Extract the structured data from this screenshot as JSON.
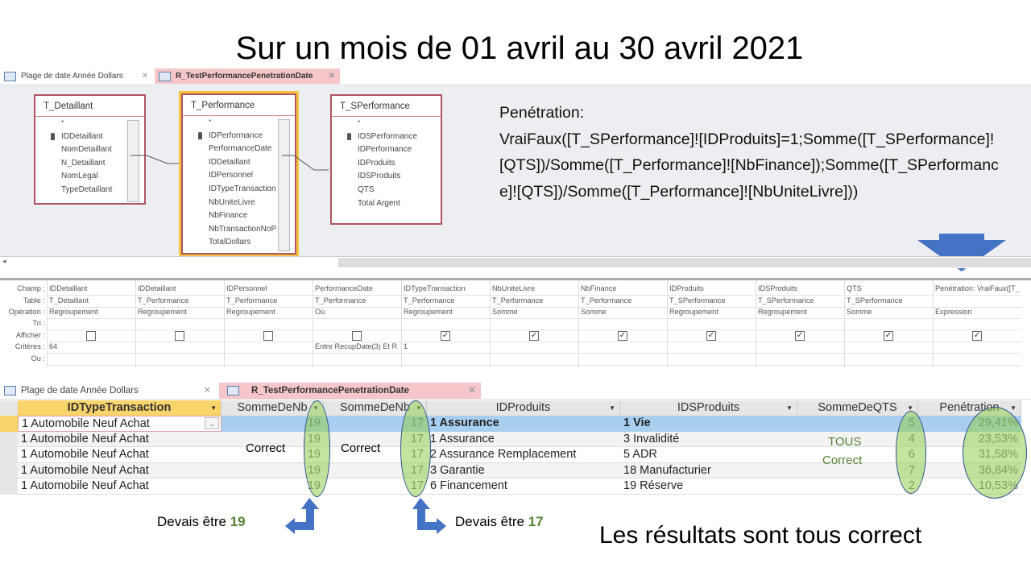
{
  "title": "Sur un mois de 01 avril au 30 avril 2021",
  "top_tabs": [
    {
      "label": "Plage de date Année Dollars"
    },
    {
      "label": "R_TestPerformancePenetrationDate"
    }
  ],
  "tables": [
    {
      "name": "T_Detaillant",
      "fields": [
        "*",
        "IDDetaillant",
        "NomDetaillant",
        "N_Detaillant",
        "NomLegal",
        "TypeDetaillant"
      ]
    },
    {
      "name": "T_Performance",
      "fields": [
        "*",
        "IDPerformance",
        "PerformanceDate",
        "IDDetaillant",
        "IDPersonnel",
        "IDTypeTransaction",
        "NbUniteLivre",
        "NbFinance",
        "NbTransactionNoP",
        "TotalDollars"
      ]
    },
    {
      "name": "T_SPerformance",
      "fields": [
        "*",
        "IDSPerformance",
        "IDPerformance",
        "IDProduits",
        "IDSProduits",
        "QTS",
        "Total Argent"
      ]
    }
  ],
  "formula": "Penétration: VraiFaux([T_SPerformance]![IDProduits]=1;Somme([T_SPerformance]![QTS])/Somme([T_Performance]![NbFinance]);Somme([T_SPerformance]![QTS])/Somme([T_Performance]![NbUniteLivre]))",
  "formula_label": "Penétration:",
  "formula_body": "VraiFaux([T_SPerformance]![IDProduits]=1;Somme([T_SPerformance]![QTS])/Somme([T_Performance]![NbFinance]);Somme([T_SPerformance]![QTS])/Somme([T_Performance]![NbUniteLivre]))",
  "grid": {
    "row_labels": [
      "Champ :",
      "Table :",
      "Opération :",
      "Tri :",
      "Afficher :",
      "Critères :",
      "Ou :"
    ],
    "columns": [
      {
        "champ": "IDDetaillant",
        "table": "T_Detaillant",
        "op": "Regroupement",
        "show": false,
        "crit": "64"
      },
      {
        "champ": "IDDetaillant",
        "table": "T_Performance",
        "op": "Regroupement",
        "show": false,
        "crit": ""
      },
      {
        "champ": "IDPersonnel",
        "table": "T_Performance",
        "op": "Regroupement",
        "show": false,
        "crit": ""
      },
      {
        "champ": "PerformanceDate",
        "table": "T_Performance",
        "op": "Où",
        "show": false,
        "crit": "Entre RecupDate(3) Et R"
      },
      {
        "champ": "IDTypeTransaction",
        "table": "T_Performance",
        "op": "Regroupement",
        "show": true,
        "crit": "1"
      },
      {
        "champ": "NbUniteLivre",
        "table": "T_Performance",
        "op": "Somme",
        "show": true,
        "crit": ""
      },
      {
        "champ": "NbFinance",
        "table": "T_Performance",
        "op": "Somme",
        "show": true,
        "crit": ""
      },
      {
        "champ": "IDProduits",
        "table": "T_SPerformance",
        "op": "Regroupement",
        "show": true,
        "crit": ""
      },
      {
        "champ": "IDSProduits",
        "table": "T_SPerformance",
        "op": "Regroupement",
        "show": true,
        "crit": ""
      },
      {
        "champ": "QTS",
        "table": "T_SPerformance",
        "op": "Somme",
        "show": true,
        "crit": ""
      },
      {
        "champ": "Penétration: VraiFaux([T_",
        "table": "",
        "op": "Expression",
        "show": true,
        "crit": ""
      }
    ]
  },
  "bottom_tabs": [
    {
      "label": "Plage de date Année Dollars"
    },
    {
      "label": "R_TestPerformancePenetrationDate"
    }
  ],
  "datasheet": {
    "headers": [
      "IDTypeTransaction",
      "SommeDeNb",
      "SommeDeNb",
      "IDProduits",
      "IDSProduits",
      "SommeDeQTS",
      "Penétration"
    ],
    "rows": [
      [
        "1 Automobile Neuf Achat",
        "19",
        "17",
        "1 Assurance",
        "1 Vie",
        "5",
        "29,41%"
      ],
      [
        "1 Automobile Neuf Achat",
        "19",
        "17",
        "1 Assurance",
        "3 Invalidité",
        "4",
        "23,53%"
      ],
      [
        "1 Automobile Neuf Achat",
        "19",
        "17",
        "2 Assurance Remplacement",
        "5 ADR",
        "6",
        "31,58%"
      ],
      [
        "1 Automobile Neuf Achat",
        "19",
        "17",
        "3 Garantie",
        "18 Manufacturier",
        "7",
        "36,84%"
      ],
      [
        "1 Automobile Neuf Achat",
        "19",
        "17",
        "6 Financement",
        "19 Réserve",
        "2",
        "10,53%"
      ]
    ]
  },
  "annotations": {
    "correct1": "Correct",
    "correct2": "Correct",
    "tous": "TOUS",
    "tous_correct": "Correct",
    "devais1_text": "Devais être",
    "devais1_val": "19",
    "devais2_text": "Devais être",
    "devais2_val": "17",
    "conclusion": "Les résultats sont tous correct"
  },
  "colors": {
    "highlight": "#92d050",
    "arrow": "#4472c4",
    "active_tab": "#f6c6c9",
    "selected_row": "#a9cff0"
  }
}
